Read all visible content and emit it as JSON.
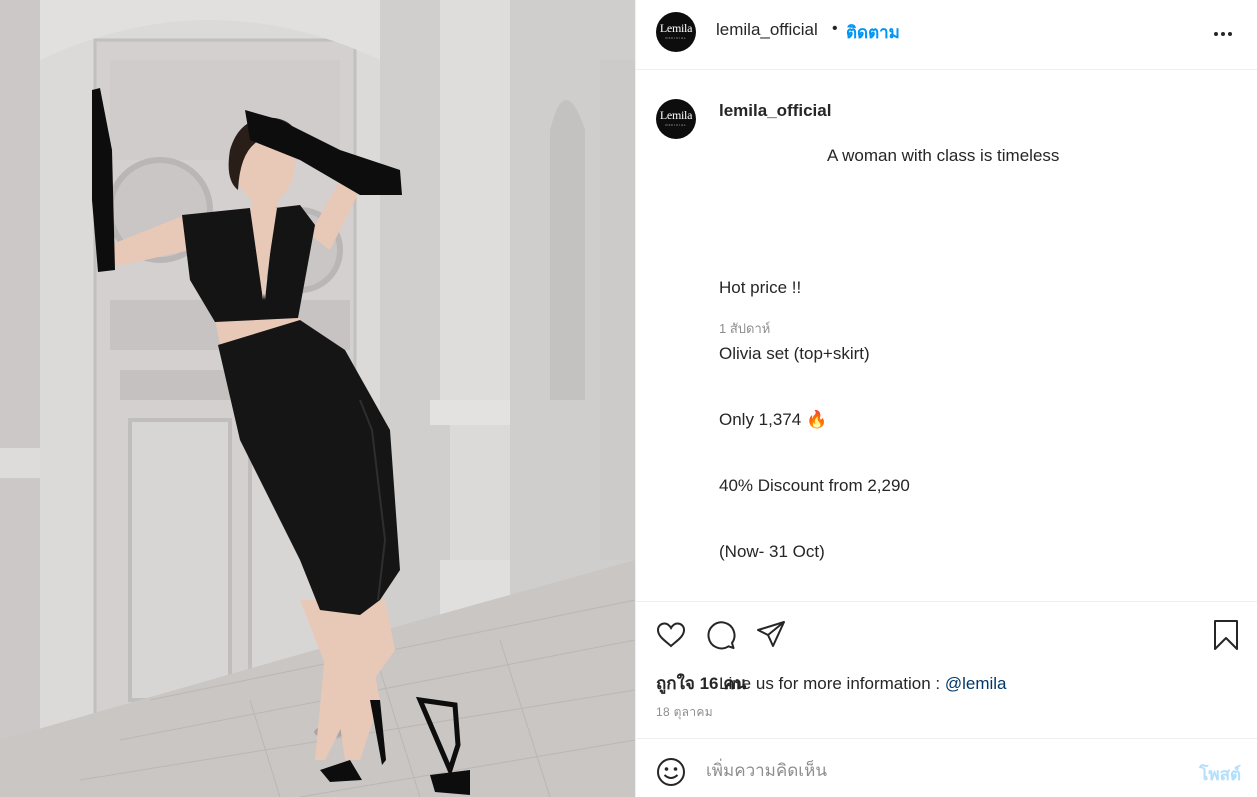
{
  "header": {
    "username": "lemila_official",
    "separator": "•",
    "follow_label": "ติดตาม",
    "avatar_logo": "Lemila",
    "avatar_logo_sub": "OFFICIAL"
  },
  "caption": {
    "username": "lemila_official",
    "text_first_line": "A woman with class is timeless",
    "lines": [
      "",
      "Hot price !!",
      "Olivia set (top+skirt)",
      "Only 1,374 🔥",
      "40% Discount from 2,290",
      "(Now- 31 Oct)",
      "",
      "Line us for more information : "
    ],
    "mention": "@lemila",
    "time_ago": "1 สัปดาห์"
  },
  "actions": {
    "likes_text": "ถูกใจ 16 คน",
    "post_date": "18 ตุลาคม",
    "icons": [
      "heart-icon",
      "comment-icon",
      "share-icon",
      "bookmark-icon"
    ]
  },
  "comment": {
    "placeholder": "เพิ่มความคิดเห็น",
    "post_label": "โพสต์"
  },
  "colors": {
    "link_blue": "#0095f6",
    "mention": "#00376b",
    "muted": "#8e8e8e",
    "post_disabled": "#b2dffc"
  }
}
